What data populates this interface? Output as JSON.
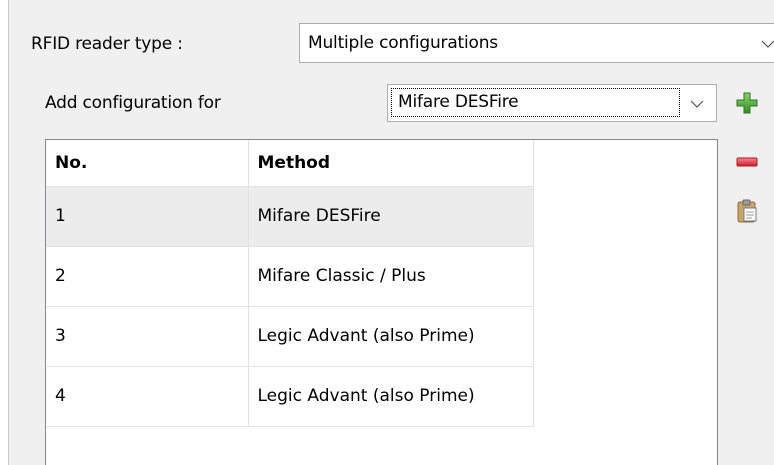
{
  "reader_type": {
    "label": "RFID reader type :",
    "value": "Multiple configurations"
  },
  "add_configuration": {
    "label": "Add configuration for",
    "value": "Mifare DESFire"
  },
  "toolbar": {
    "add_icon": "plus-icon",
    "remove_icon": "minus-icon",
    "paste_icon": "clipboard-paste-icon"
  },
  "table": {
    "columns": [
      "No.",
      "Method"
    ],
    "rows": [
      {
        "no": "1",
        "method": "Mifare DESFire",
        "selected": true
      },
      {
        "no": "2",
        "method": "Mifare Classic / Plus",
        "selected": false
      },
      {
        "no": "3",
        "method": "Legic Advant (also Prime)",
        "selected": false
      },
      {
        "no": "4",
        "method": "Legic Advant (also Prime)",
        "selected": false
      }
    ]
  },
  "colors": {
    "add": "#3fa535",
    "remove": "#e0303a",
    "selected_row": "#ececec",
    "panel_background": "#f0f0f0"
  }
}
